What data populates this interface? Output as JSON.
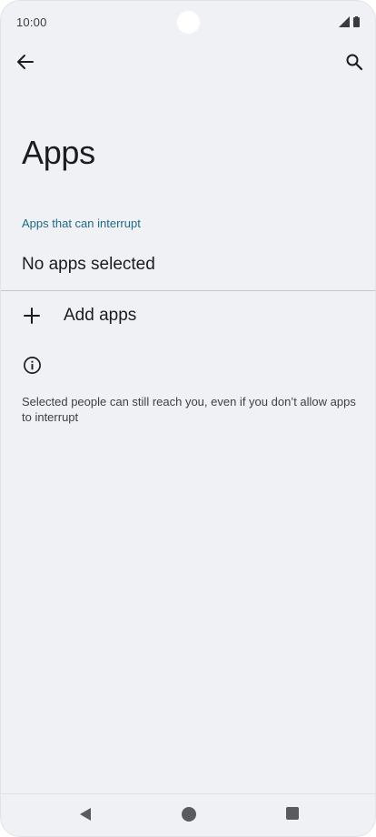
{
  "status_bar": {
    "time": "10:00"
  },
  "toolbar": {
    "back_icon": "arrow-back-icon",
    "search_icon": "search-icon"
  },
  "page": {
    "title": "Apps",
    "section_header": "Apps that can interrupt",
    "selected_summary": "No apps selected",
    "add_apps_label": "Add apps",
    "add_icon": "plus-icon",
    "info_icon": "info-icon",
    "footer_text": "Selected people can still reach you, even if you don’t allow apps to interrupt"
  },
  "colors": {
    "background": "#f0f1f4",
    "accent": "#1f6a86",
    "text_primary": "#1b1c1f"
  }
}
